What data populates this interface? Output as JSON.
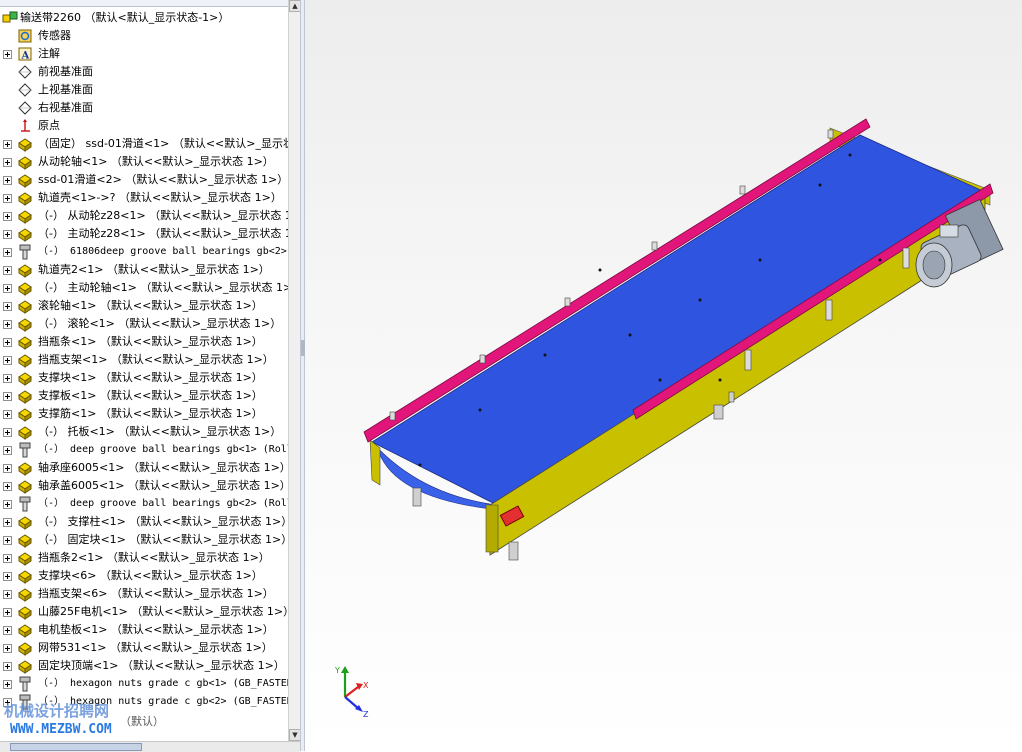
{
  "tree": {
    "root": "输送带2260  （默认<默认_显示状态-1>）",
    "items": [
      {
        "label": "传感器",
        "icon": "sensor-icon",
        "expandable": false
      },
      {
        "label": "注解",
        "icon": "annotation-icon",
        "expandable": true
      },
      {
        "label": "前视基准面",
        "icon": "plane-icon",
        "expandable": false
      },
      {
        "label": "上视基准面",
        "icon": "plane-icon",
        "expandable": false
      },
      {
        "label": "右视基准面",
        "icon": "plane-icon",
        "expandable": false
      },
      {
        "label": "原点",
        "icon": "origin-icon",
        "expandable": false
      },
      {
        "label": "（固定） ssd-01滑道<1> （默认<<默认>_显示状态",
        "icon": "part-icon",
        "expandable": true
      },
      {
        "label": "从动轮轴<1> （默认<<默认>_显示状态 1>）",
        "icon": "part-icon",
        "expandable": true
      },
      {
        "label": "ssd-01滑道<2> （默认<<默认>_显示状态 1>）",
        "icon": "part-icon",
        "expandable": true
      },
      {
        "label": "轨道壳<1>->? （默认<<默认>_显示状态 1>）",
        "icon": "part-icon",
        "expandable": true
      },
      {
        "label": "（-） 从动轮z28<1> （默认<<默认>_显示状态 1>）",
        "icon": "part-icon",
        "expandable": true
      },
      {
        "label": "（-） 主动轮z28<1> （默认<<默认>_显示状态 1>）",
        "icon": "part-icon",
        "expandable": true
      },
      {
        "label": "（-） 61806deep groove ball bearings gb<2>",
        "icon": "bolt-icon",
        "expandable": true,
        "mono": true
      },
      {
        "label": "轨道壳2<1> （默认<<默认>_显示状态 1>）",
        "icon": "part-icon",
        "expandable": true
      },
      {
        "label": "（-） 主动轮轴<1> （默认<<默认>_显示状态 1>）",
        "icon": "part-icon",
        "expandable": true
      },
      {
        "label": "滚轮轴<1> （默认<<默认>_显示状态 1>）",
        "icon": "part-icon",
        "expandable": true
      },
      {
        "label": "（-） 滚轮<1> （默认<<默认>_显示状态 1>）",
        "icon": "part-icon",
        "expandable": true
      },
      {
        "label": "挡瓶条<1> （默认<<默认>_显示状态 1>）",
        "icon": "part-icon",
        "expandable": true
      },
      {
        "label": "挡瓶支架<1> （默认<<默认>_显示状态 1>）",
        "icon": "part-icon",
        "expandable": true
      },
      {
        "label": "支撑块<1> （默认<<默认>_显示状态 1>）",
        "icon": "part-icon",
        "expandable": true
      },
      {
        "label": "支撑板<1> （默认<<默认>_显示状态 1>）",
        "icon": "part-icon",
        "expandable": true
      },
      {
        "label": "支撑筋<1> （默认<<默认>_显示状态 1>）",
        "icon": "part-icon",
        "expandable": true
      },
      {
        "label": "（-） 托板<1> （默认<<默认>_显示状态 1>）",
        "icon": "part-icon",
        "expandable": true
      },
      {
        "label": "（-） deep groove ball bearings gb<1> (Roll",
        "icon": "bolt-icon",
        "expandable": true,
        "mono": true
      },
      {
        "label": "轴承座6005<1> （默认<<默认>_显示状态 1>）",
        "icon": "part-icon",
        "expandable": true
      },
      {
        "label": "轴承盖6005<1> （默认<<默认>_显示状态 1>）",
        "icon": "part-icon",
        "expandable": true
      },
      {
        "label": "（-） deep groove ball bearings gb<2> (Roll",
        "icon": "bolt-icon",
        "expandable": true,
        "mono": true
      },
      {
        "label": "（-） 支撑柱<1> （默认<<默认>_显示状态 1>）",
        "icon": "part-icon",
        "expandable": true
      },
      {
        "label": "（-） 固定块<1> （默认<<默认>_显示状态 1>）",
        "icon": "part-icon",
        "expandable": true
      },
      {
        "label": "挡瓶条2<1> （默认<<默认>_显示状态 1>）",
        "icon": "part-icon",
        "expandable": true
      },
      {
        "label": "支撑块<6> （默认<<默认>_显示状态 1>）",
        "icon": "part-icon",
        "expandable": true
      },
      {
        "label": "挡瓶支架<6> （默认<<默认>_显示状态 1>）",
        "icon": "part-icon",
        "expandable": true
      },
      {
        "label": "山藤25F电机<1> （默认<<默认>_显示状态 1>）",
        "icon": "part-icon",
        "expandable": true
      },
      {
        "label": "电机垫板<1> （默认<<默认>_显示状态 1>）",
        "icon": "part-icon",
        "expandable": true
      },
      {
        "label": "网带531<1> （默认<<默认>_显示状态 1>）",
        "icon": "part-icon",
        "expandable": true
      },
      {
        "label": "固定块顶端<1> （默认<<默认>_显示状态 1>）",
        "icon": "part-icon",
        "expandable": true
      },
      {
        "label": "（-） hexagon nuts grade c gb<1> (GB_FASTEN",
        "icon": "bolt-icon",
        "expandable": true,
        "mono": true
      },
      {
        "label": "（-） hexagon nuts grade c gb<2> (GB_FASTEN",
        "icon": "bolt-icon",
        "expandable": true,
        "mono": true
      }
    ],
    "partial_last": "（默认）"
  },
  "viewport": {
    "triad": {
      "x": "X",
      "y": "Y",
      "z": "Z"
    }
  },
  "watermark": {
    "line1": "机械设计招聘网",
    "line2": "WWW.MEZBW.COM"
  },
  "colors": {
    "belt": "#2f55e0",
    "rail": "#e2167a",
    "frame": "#c9c100",
    "motor": "#8d98a8"
  }
}
